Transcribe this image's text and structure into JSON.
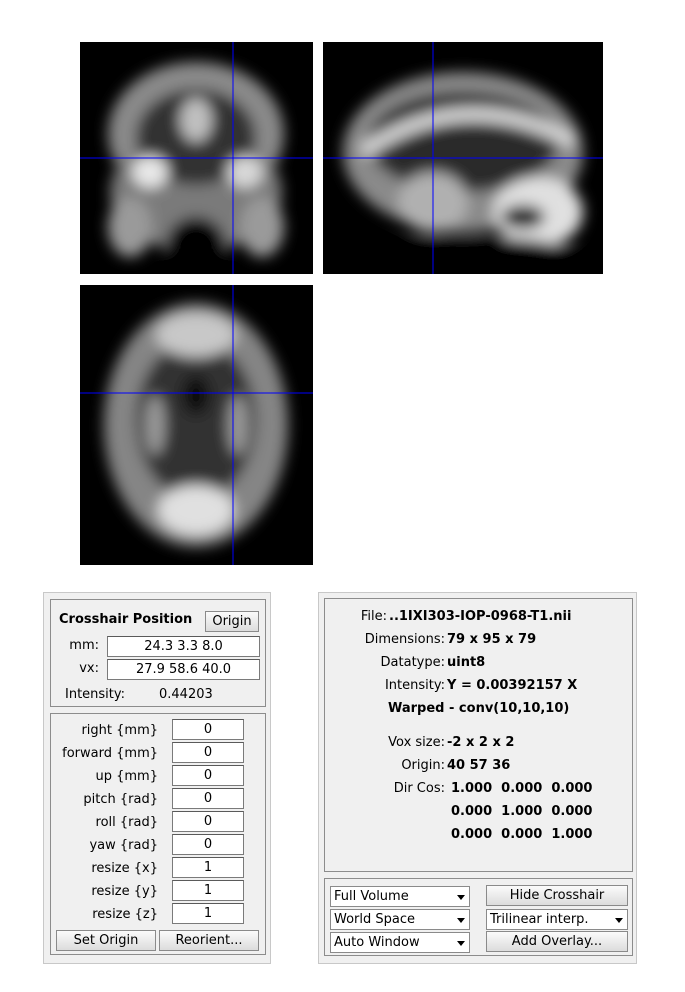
{
  "crosshair": {
    "title": "Crosshair Position",
    "origin_button": "Origin",
    "mm_label": "mm:",
    "mm_value": "24.3 3.3 8.0",
    "vx_label": "vx:",
    "vx_value": "27.9 58.6 40.0",
    "intensity_label": "Intensity:",
    "intensity_value": "0.44203"
  },
  "reorient": {
    "fields": [
      {
        "label": "right  {mm}",
        "value": "0"
      },
      {
        "label": "forward  {mm}",
        "value": "0"
      },
      {
        "label": "up  {mm}",
        "value": "0"
      },
      {
        "label": "pitch  {rad}",
        "value": "0"
      },
      {
        "label": "roll  {rad}",
        "value": "0"
      },
      {
        "label": "yaw  {rad}",
        "value": "0"
      },
      {
        "label": "resize  {x}",
        "value": "1"
      },
      {
        "label": "resize  {y}",
        "value": "1"
      },
      {
        "label": "resize  {z}",
        "value": "1"
      }
    ],
    "set_origin_button": "Set Origin",
    "reorient_button": "Reorient..."
  },
  "info": {
    "file_label": "File:",
    "file_value": "..1IXI303-IOP-0968-T1.nii",
    "dimensions_label": "Dimensions:",
    "dimensions_value": "79 x 95 x 79",
    "datatype_label": "Datatype:",
    "datatype_value": "uint8",
    "intensity_label": "Intensity:",
    "intensity_value": "Y = 0.00392157 X",
    "description": "Warped - conv(10,10,10)",
    "voxsize_label": "Vox size:",
    "voxsize_value": "-2 x 2 x 2",
    "origin_label": "Origin:",
    "origin_value": "40 57 36",
    "dircos_label": "Dir Cos:",
    "dircos_rows": [
      "1.000  0.000  0.000",
      "0.000  1.000  0.000",
      "0.000  0.000  1.000"
    ]
  },
  "controls": {
    "volume_select": "Full Volume",
    "space_select": "World Space",
    "window_select": "Auto Window",
    "interp_select": "Trilinear interp.",
    "hide_crosshair_button": "Hide Crosshair",
    "add_overlay_button": "Add Overlay..."
  },
  "colors": {
    "crosshair": "#0000ff",
    "view_background": "#000000",
    "panel_background": "#f0f0f0"
  }
}
